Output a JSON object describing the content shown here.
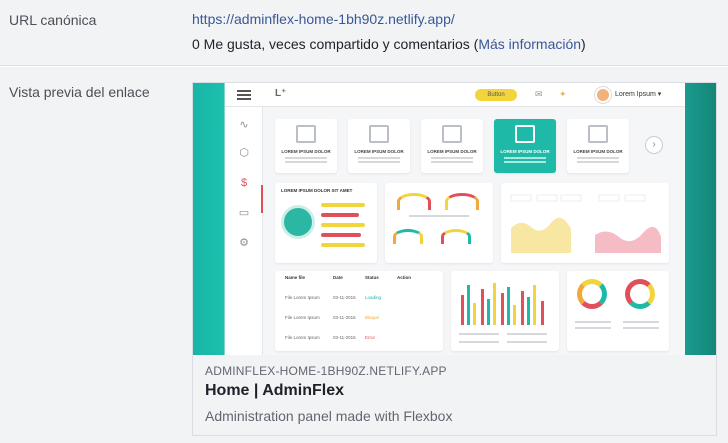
{
  "canonical_url": {
    "label": "URL canónica",
    "url": "https://adminflex-home-1bh90z.netlify.app/",
    "stats_text": "0 Me gusta, veces compartido y comentarios (",
    "more_info": "Más información",
    "stats_close": ")"
  },
  "link_preview": {
    "label": "Vista previa del enlace",
    "domain": "ADMINFLEX-HOME-1BH90Z.NETLIFY.APP",
    "title": "Home | AdminFlex",
    "description": "Administration panel made with Flexbox",
    "image": {
      "button_label": "Button",
      "user_name": "Lorem Ipsum ▾",
      "tile_labels": [
        "LOREM IPSUM DOLOR",
        "LOREM IPSUM DOLOR",
        "LOREM IPSUM DOLOR",
        "LOREM IPSUM DOLOR",
        "LOREM IPSUM DOLOR"
      ],
      "map_panel_title": "LOREM IPSUM DOLOR SIT AMET",
      "table_headers": [
        "Name file",
        "Date",
        "Status",
        "Action"
      ],
      "table_rows": [
        {
          "name": "File Lorem Ipsum",
          "date": "03-11-2016",
          "status": "Loading"
        },
        {
          "name": "File Lorem Ipsum",
          "date": "03-11-2016",
          "status": "Bloqué"
        },
        {
          "name": "File Lorem Ipsum",
          "date": "03-11-2016",
          "status": "Error"
        }
      ],
      "accent_color": "#1fb9a8"
    }
  }
}
